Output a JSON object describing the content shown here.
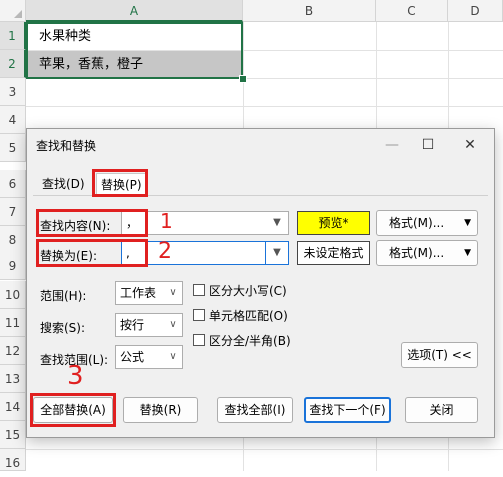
{
  "sheet": {
    "columns": [
      "A",
      "B",
      "C",
      "D"
    ],
    "rows": [
      "1",
      "2",
      "3",
      "4",
      "5",
      "6",
      "7",
      "8",
      "9",
      "10",
      "11",
      "12",
      "13",
      "14",
      "15",
      "16"
    ],
    "cells": {
      "a1": "水果种类",
      "a2": "苹果，香蕉，橙子"
    }
  },
  "dialog": {
    "title": "查找和替换",
    "controls": {
      "minimize": "—",
      "maximize": "☐",
      "close": "✕"
    },
    "tabs": {
      "find": "查找(D)",
      "replace": "替换(P)"
    },
    "find_label": "查找内容(N):",
    "find_value": "，",
    "preview_label": "预览*",
    "format_label": "格式(M)...",
    "replace_label": "替换为(E):",
    "replace_value": ",",
    "no_format_label": "未设定格式",
    "scope_label": "范围(H):",
    "scope_value": "工作表",
    "search_label": "搜索(S):",
    "search_value": "按行",
    "lookin_label": "查找范围(L):",
    "lookin_value": "公式",
    "match_case": "区分大小写(C)",
    "match_cell": "单元格匹配(O)",
    "match_width": "区分全/半角(B)",
    "options_button": "选项(T) <<",
    "buttons": {
      "replace_all": "全部替换(A)",
      "replace": "替换(R)",
      "find_all": "查找全部(I)",
      "find_next": "查找下一个(F)",
      "close": "关闭"
    }
  },
  "annotations": {
    "n1": "1",
    "n2": "2",
    "n3": "3"
  }
}
